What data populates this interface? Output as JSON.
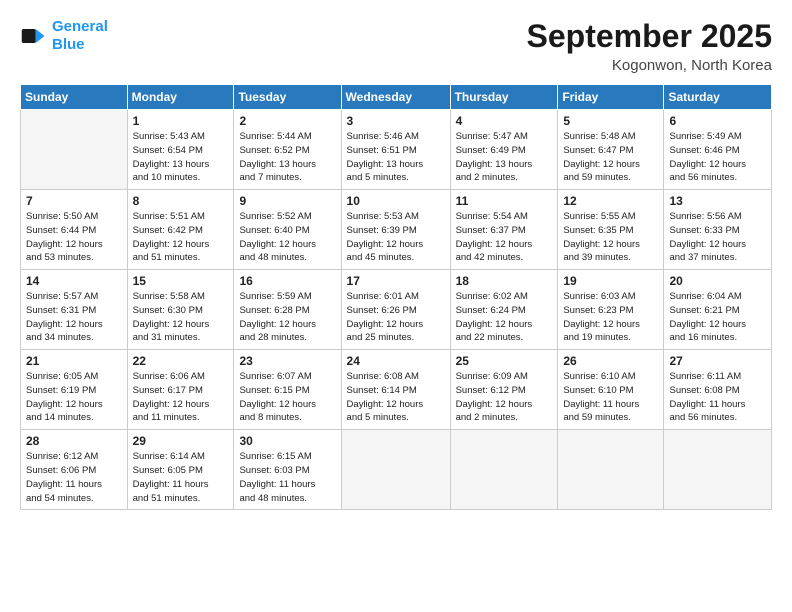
{
  "logo": {
    "line1": "General",
    "line2": "Blue"
  },
  "title": "September 2025",
  "location": "Kogonwon, North Korea",
  "days_header": [
    "Sunday",
    "Monday",
    "Tuesday",
    "Wednesday",
    "Thursday",
    "Friday",
    "Saturday"
  ],
  "weeks": [
    [
      {
        "day": "",
        "detail": ""
      },
      {
        "day": "1",
        "detail": "Sunrise: 5:43 AM\nSunset: 6:54 PM\nDaylight: 13 hours\nand 10 minutes."
      },
      {
        "day": "2",
        "detail": "Sunrise: 5:44 AM\nSunset: 6:52 PM\nDaylight: 13 hours\nand 7 minutes."
      },
      {
        "day": "3",
        "detail": "Sunrise: 5:46 AM\nSunset: 6:51 PM\nDaylight: 13 hours\nand 5 minutes."
      },
      {
        "day": "4",
        "detail": "Sunrise: 5:47 AM\nSunset: 6:49 PM\nDaylight: 13 hours\nand 2 minutes."
      },
      {
        "day": "5",
        "detail": "Sunrise: 5:48 AM\nSunset: 6:47 PM\nDaylight: 12 hours\nand 59 minutes."
      },
      {
        "day": "6",
        "detail": "Sunrise: 5:49 AM\nSunset: 6:46 PM\nDaylight: 12 hours\nand 56 minutes."
      }
    ],
    [
      {
        "day": "7",
        "detail": "Sunrise: 5:50 AM\nSunset: 6:44 PM\nDaylight: 12 hours\nand 53 minutes."
      },
      {
        "day": "8",
        "detail": "Sunrise: 5:51 AM\nSunset: 6:42 PM\nDaylight: 12 hours\nand 51 minutes."
      },
      {
        "day": "9",
        "detail": "Sunrise: 5:52 AM\nSunset: 6:40 PM\nDaylight: 12 hours\nand 48 minutes."
      },
      {
        "day": "10",
        "detail": "Sunrise: 5:53 AM\nSunset: 6:39 PM\nDaylight: 12 hours\nand 45 minutes."
      },
      {
        "day": "11",
        "detail": "Sunrise: 5:54 AM\nSunset: 6:37 PM\nDaylight: 12 hours\nand 42 minutes."
      },
      {
        "day": "12",
        "detail": "Sunrise: 5:55 AM\nSunset: 6:35 PM\nDaylight: 12 hours\nand 39 minutes."
      },
      {
        "day": "13",
        "detail": "Sunrise: 5:56 AM\nSunset: 6:33 PM\nDaylight: 12 hours\nand 37 minutes."
      }
    ],
    [
      {
        "day": "14",
        "detail": "Sunrise: 5:57 AM\nSunset: 6:31 PM\nDaylight: 12 hours\nand 34 minutes."
      },
      {
        "day": "15",
        "detail": "Sunrise: 5:58 AM\nSunset: 6:30 PM\nDaylight: 12 hours\nand 31 minutes."
      },
      {
        "day": "16",
        "detail": "Sunrise: 5:59 AM\nSunset: 6:28 PM\nDaylight: 12 hours\nand 28 minutes."
      },
      {
        "day": "17",
        "detail": "Sunrise: 6:01 AM\nSunset: 6:26 PM\nDaylight: 12 hours\nand 25 minutes."
      },
      {
        "day": "18",
        "detail": "Sunrise: 6:02 AM\nSunset: 6:24 PM\nDaylight: 12 hours\nand 22 minutes."
      },
      {
        "day": "19",
        "detail": "Sunrise: 6:03 AM\nSunset: 6:23 PM\nDaylight: 12 hours\nand 19 minutes."
      },
      {
        "day": "20",
        "detail": "Sunrise: 6:04 AM\nSunset: 6:21 PM\nDaylight: 12 hours\nand 16 minutes."
      }
    ],
    [
      {
        "day": "21",
        "detail": "Sunrise: 6:05 AM\nSunset: 6:19 PM\nDaylight: 12 hours\nand 14 minutes."
      },
      {
        "day": "22",
        "detail": "Sunrise: 6:06 AM\nSunset: 6:17 PM\nDaylight: 12 hours\nand 11 minutes."
      },
      {
        "day": "23",
        "detail": "Sunrise: 6:07 AM\nSunset: 6:15 PM\nDaylight: 12 hours\nand 8 minutes."
      },
      {
        "day": "24",
        "detail": "Sunrise: 6:08 AM\nSunset: 6:14 PM\nDaylight: 12 hours\nand 5 minutes."
      },
      {
        "day": "25",
        "detail": "Sunrise: 6:09 AM\nSunset: 6:12 PM\nDaylight: 12 hours\nand 2 minutes."
      },
      {
        "day": "26",
        "detail": "Sunrise: 6:10 AM\nSunset: 6:10 PM\nDaylight: 11 hours\nand 59 minutes."
      },
      {
        "day": "27",
        "detail": "Sunrise: 6:11 AM\nSunset: 6:08 PM\nDaylight: 11 hours\nand 56 minutes."
      }
    ],
    [
      {
        "day": "28",
        "detail": "Sunrise: 6:12 AM\nSunset: 6:06 PM\nDaylight: 11 hours\nand 54 minutes."
      },
      {
        "day": "29",
        "detail": "Sunrise: 6:14 AM\nSunset: 6:05 PM\nDaylight: 11 hours\nand 51 minutes."
      },
      {
        "day": "30",
        "detail": "Sunrise: 6:15 AM\nSunset: 6:03 PM\nDaylight: 11 hours\nand 48 minutes."
      },
      {
        "day": "",
        "detail": ""
      },
      {
        "day": "",
        "detail": ""
      },
      {
        "day": "",
        "detail": ""
      },
      {
        "day": "",
        "detail": ""
      }
    ]
  ]
}
